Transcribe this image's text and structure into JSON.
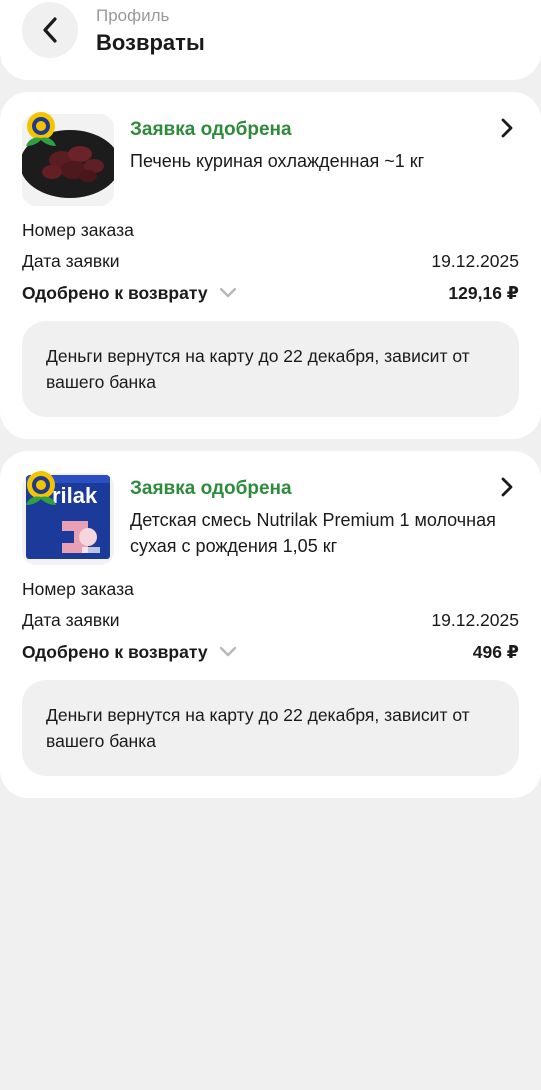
{
  "header": {
    "subtitle": "Профиль",
    "title": "Возвраты"
  },
  "returns": [
    {
      "status": "Заявка одобрена",
      "product": "Печень куриная охлажденная ~1 кг",
      "order_label": "Номер заказа",
      "order_value": "",
      "date_label": "Дата заявки",
      "date_value": "19.12.2025",
      "approved_label": "Одобрено к возврату",
      "approved_value": "129,16 ₽",
      "notice": "Деньги вернутся на карту до 22 декабря, зависит от вашего банка",
      "thumb_icon": "chicken-liver-image"
    },
    {
      "status": "Заявка одобрена",
      "product": "Детская смесь Nutrilak Premium 1 молочная сухая с рождения 1,05 кг",
      "order_label": "Номер заказа",
      "order_value": "",
      "date_label": "Дата заявки",
      "date_value": "19.12.2025",
      "approved_label": "Одобрено к возврату",
      "approved_value": "496 ₽",
      "notice": "Деньги вернутся на карту до 22 декабря, зависит от вашего банка",
      "thumb_icon": "nutrilak-package-image",
      "thumb_text": "rilak"
    }
  ],
  "colors": {
    "status_green": "#2e8b3c",
    "background": "#f0f0f0",
    "card": "#ffffff"
  }
}
